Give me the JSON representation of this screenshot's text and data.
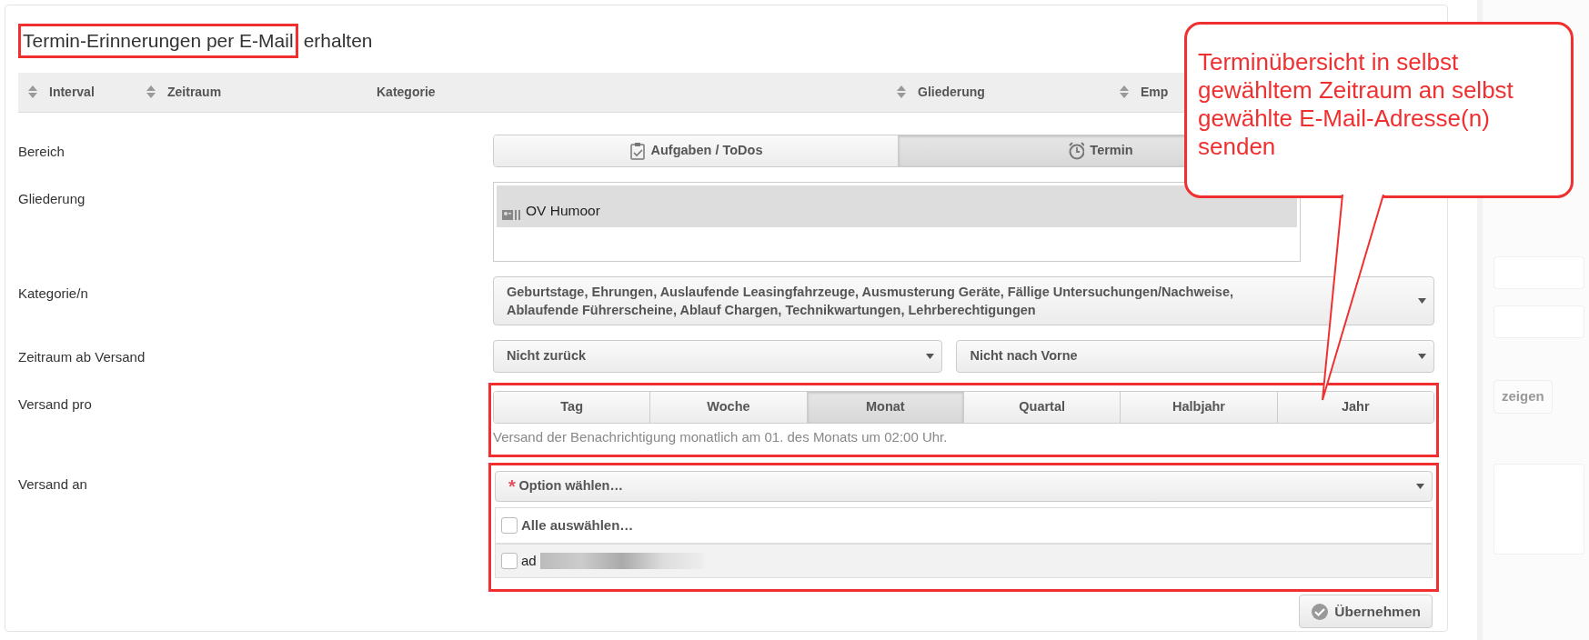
{
  "title": [
    {
      "text": "Termin-Erinnerungen per E-Mail",
      "highlighted": true
    },
    {
      "text": "erhalten",
      "highlighted": false
    }
  ],
  "table": {
    "columns": [
      {
        "label": "Interval",
        "sortable": true
      },
      {
        "label": "Zeitraum",
        "sortable": true
      },
      {
        "label": "Kategorie",
        "sortable": false
      },
      {
        "label": "Gliederung",
        "sortable": true
      },
      {
        "label": "Emp",
        "sortable": true
      }
    ]
  },
  "form": [
    {
      "kind": "icon-segmented",
      "label": "Bereich",
      "highlighted": false,
      "options": [
        {
          "label": "Aufgaben / ToDos",
          "selected": false
        },
        {
          "label": "Termin",
          "selected": true
        }
      ]
    },
    {
      "kind": "tags",
      "label": "Gliederung",
      "highlighted": false,
      "tags": [
        "OV Humoor"
      ]
    },
    {
      "kind": "select",
      "label": "Kategorie/n",
      "highlighted": false,
      "value": "Geburtstage, Ehrungen, Auslaufende Leasingfahrzeuge, Ausmusterung Geräte, Fällige Untersuchungen/Nachweise, Ablaufende Führerscheine, Ablauf Chargen, Technikwartungen, Lehrberechtigungen"
    },
    {
      "kind": "dual-select",
      "label": "Zeitraum ab Versand",
      "highlighted": false,
      "values": [
        "Nicht zurück",
        "Nicht nach Vorne"
      ]
    },
    {
      "kind": "segmented",
      "label": "Versand pro",
      "highlighted": true,
      "options": [
        {
          "label": "Tag",
          "selected": false
        },
        {
          "label": "Woche",
          "selected": false
        },
        {
          "label": "Monat",
          "selected": true
        },
        {
          "label": "Quartal",
          "selected": false
        },
        {
          "label": "Halbjahr",
          "selected": false
        },
        {
          "label": "Jahr",
          "selected": false
        }
      ],
      "note": "Versand der Benachrichtigung monatlich am 01. des Monats um 02:00 Uhr."
    },
    {
      "kind": "multiselect",
      "label": "Versand an",
      "highlighted": true,
      "required_mark": "*",
      "placeholder": "Option wählen…",
      "options": [
        {
          "kind": "select-all",
          "label": "Alle auswählen…",
          "checked": false
        },
        {
          "kind": "address",
          "label": "ad",
          "checked": false
        }
      ]
    }
  ],
  "submit": "Übernehmen",
  "callout": "Terminübersicht in selbst gewähltem Zeitraum an selbst gewählte E-Mail-Adresse(n) senden",
  "side_panel": {
    "button": "zeigen"
  }
}
